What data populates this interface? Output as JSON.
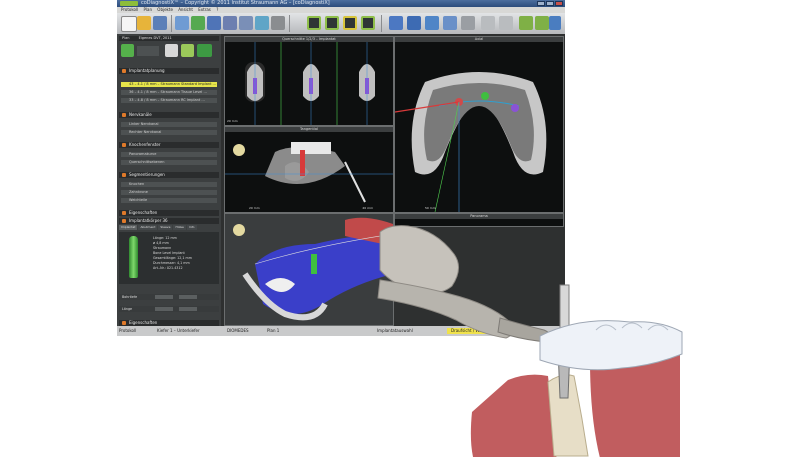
{
  "window": {
    "title": "coDiagnostiX™ – Copyright © 2011 Institut Straumann AG – [coDiagnostiX]",
    "menu": [
      "Protokoll",
      "Plan",
      "Objekte",
      "Ansicht",
      "Extras",
      "?"
    ]
  },
  "toolbar": {
    "icons": [
      "new-icon",
      "open-icon",
      "save-icon",
      "print-icon",
      "import-icon",
      "segment-icon",
      "implant-icon",
      "sleeve-icon",
      "ruler-icon",
      "screenshot-icon",
      "layout-icon",
      "views-icon",
      "arrow-icon",
      "nerve-icon",
      "align-icon",
      "group-icon",
      "rotate-icon",
      "pan-icon",
      "zoom-icon",
      "undo-icon",
      "redo-icon",
      "forward-icon",
      "back-icon",
      "home-icon"
    ]
  },
  "left_panel": {
    "header_plan": "Plan",
    "plan_name": "Eigenes DVT, 2011",
    "sections": [
      {
        "title": "Implantatplanung",
        "rows": [
          "43 – 4.1 / 8 mm – Straumann Standard Implant …",
          "36 – 4.1 / 8 mm – Straumann Tissue Level …",
          "33 – 4.8 / 8 mm – Straumann RC Implant …"
        ]
      },
      {
        "title": "Nervkanäle",
        "rows": [
          "Linker Nervkanal",
          "Rechter Nervkanal"
        ]
      },
      {
        "title": "Knochenfenster",
        "rows": [
          "Panoramakurve",
          "Querschnittsebenen"
        ]
      },
      {
        "title": "Segmentierungen",
        "rows": [
          "Knochen",
          "Zahnkrone",
          "Weichteile"
        ]
      }
    ],
    "properties_title": "Eigenschaften",
    "implant_title": "Implantatkörper 36",
    "implant_tabs": [
      "Implantat",
      "Abutment",
      "Sleeve",
      "Hülse",
      "Info"
    ],
    "implant_info": [
      "Länge: 12 mm",
      "ø 4,8 mm",
      "Straumann",
      "Bone Level Implant",
      "Gesamtlänge: 12,1 mm",
      "Durchmesser: 4,1 mm",
      "Art.-Nr.: 021.4312"
    ],
    "depth_label": "Bohrtiefe",
    "length_label": "Länge",
    "footer": "Eigenschaften"
  },
  "viewports": {
    "cross_section": "Querschnitte 1/2/3 – Implantat",
    "axial": "Axial",
    "tangential": "Tangential",
    "panorama": "Panorama",
    "scale_labels": [
      "20 mm",
      "20 mm",
      "20 mm",
      "50 mm",
      "50 mm"
    ]
  },
  "status": {
    "items": [
      "Protokoll",
      "Kiefer 1 – Unterkiefer",
      "DIOMEDES",
      "Plan 1"
    ],
    "center": "Implantatauswahl",
    "mode": "Draufsicht / Wählen"
  },
  "colors": {
    "accent": "#e6e44a",
    "bone": "#c9bda2",
    "mandible": "#3a3fc9",
    "gum": "#c15d5f",
    "handpiece": "#b7b4ad",
    "crown": "#eef2f8"
  }
}
